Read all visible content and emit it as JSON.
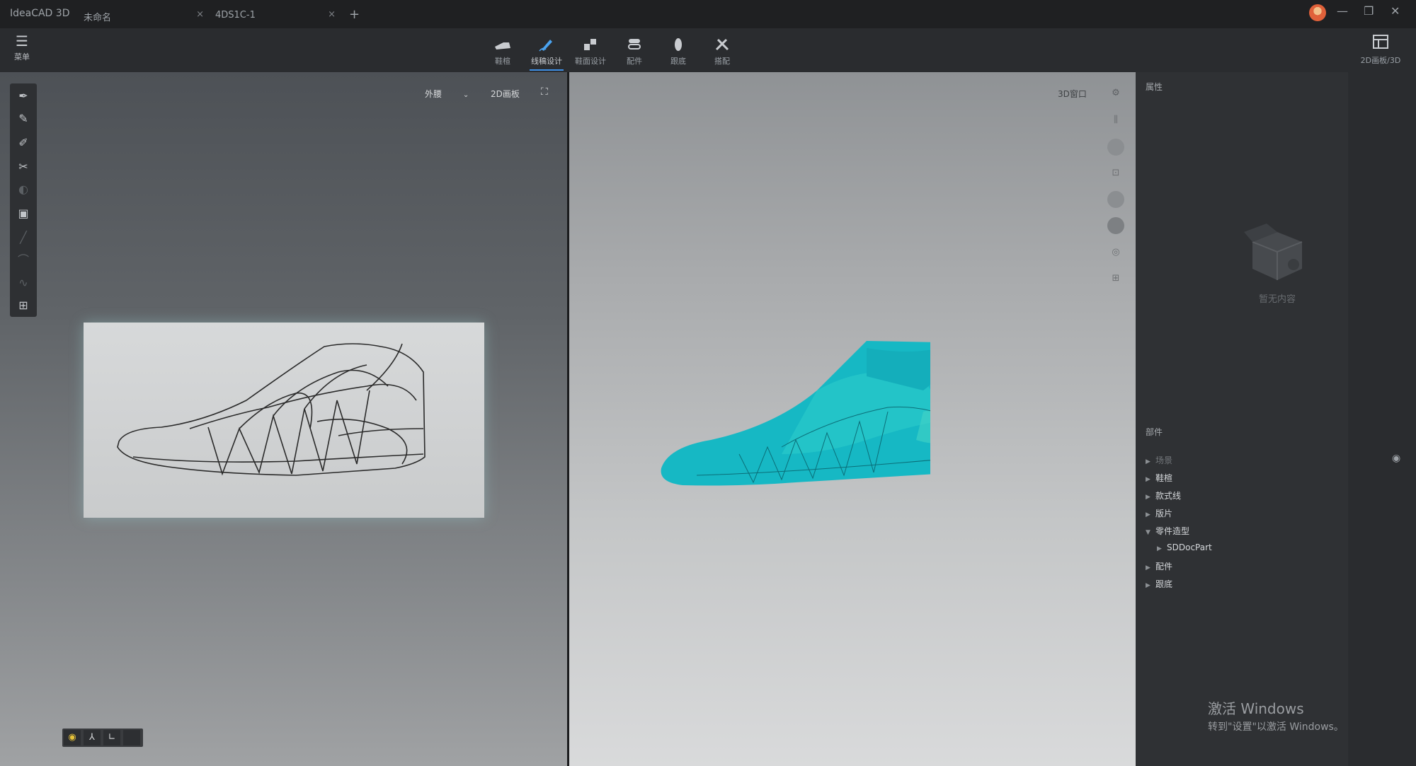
{
  "titlebar": {
    "app_name": "IdeaCAD 3D",
    "tabs": [
      {
        "label": "未命名",
        "close": "×"
      },
      {
        "label": "4DS1C-1",
        "close": "×"
      }
    ],
    "add_tab": "+",
    "minimize": "—",
    "restore": "❐",
    "close": "✕"
  },
  "ribbon": {
    "menu_label": "菜单",
    "tools": [
      {
        "label": "鞋楦",
        "icon": "shoe-last-icon"
      },
      {
        "label": "线稿设计",
        "icon": "pen-line-icon",
        "active": true
      },
      {
        "label": "鞋面设计",
        "icon": "upper-design-icon"
      },
      {
        "label": "配件",
        "icon": "accessory-icon"
      },
      {
        "label": "跟底",
        "icon": "sole-icon"
      },
      {
        "label": "搭配",
        "icon": "match-icon"
      }
    ],
    "right_tool_label": "2D画板/3D"
  },
  "view2d": {
    "side_select": "外腰",
    "board_label": "2D画板"
  },
  "view3d": {
    "window_label": "3D窗口"
  },
  "panel": {
    "properties_title": "属性",
    "empty_text": "暂无内容",
    "parts_title": "部件",
    "tree": [
      {
        "label": "场景",
        "dim": true
      },
      {
        "label": "鞋楦"
      },
      {
        "label": "款式线"
      },
      {
        "label": "版片"
      },
      {
        "label": "零件造型",
        "expanded": true
      },
      {
        "label": "SDDocPart",
        "child": true
      },
      {
        "label": "配件"
      },
      {
        "label": "跟底"
      }
    ]
  },
  "watermark": {
    "line1": "激活 Windows",
    "line2": "转到\"设置\"以激活 Windows。"
  },
  "colors": {
    "accent": "#3d8fe6",
    "shoe_3d": "#16b8c4"
  }
}
